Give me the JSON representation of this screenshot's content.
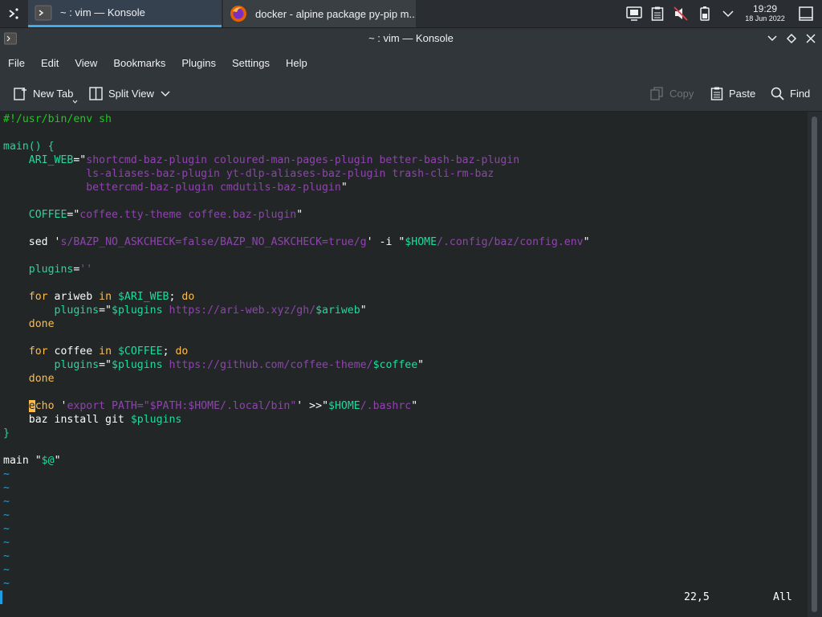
{
  "taskbar": {
    "launcher_icon": "application-launcher-icon",
    "tasks": [
      {
        "label": "~ : vim — Konsole",
        "icon": "konsole-icon",
        "active": true
      },
      {
        "label": "docker - alpine package py-pip m...",
        "icon": "firefox-icon",
        "active": false
      }
    ],
    "tray_icons": [
      "screen-icon",
      "clipboard-icon",
      "volume-muted-icon",
      "battery-icon",
      "chevron-up-icon"
    ],
    "clock": {
      "time": "19:29",
      "date": "18 Jun 2022"
    }
  },
  "window": {
    "title": "~ : vim — Konsole",
    "buttons": [
      "minimize-icon",
      "maximize-icon",
      "close-icon"
    ]
  },
  "menu": [
    "File",
    "Edit",
    "View",
    "Bookmarks",
    "Plugins",
    "Settings",
    "Help"
  ],
  "toolbar": {
    "new_tab": "New Tab",
    "split_view": "Split View",
    "copy": "Copy",
    "paste": "Paste",
    "find": "Find"
  },
  "editor": {
    "shebang": "#!/usr/bin/env sh",
    "func_decl": "main() {",
    "ari_name": "ARI_WEB",
    "ari_val1": "shortcmd-baz-plugin coloured-man-pages-plugin better-bash-baz-plugin",
    "ari_val2": "ls-aliases-baz-plugin yt-dlp-aliases-baz-plugin trash-cli-rm-baz",
    "ari_val3": "bettercmd-baz-plugin cmdutils-baz-plugin",
    "coffee_name": "COFFEE",
    "coffee_val": "coffee.tty-theme coffee.baz-plugin",
    "sed_cmd": "sed",
    "sed_expr": "s/BAZP_NO_ASKCHECK=false/BAZP_NO_ASKCHECK=true/g",
    "sed_opt": "-i",
    "home_var": "$HOME",
    "sed_path": "/.config/baz/config.env",
    "plugins_name": "plugins",
    "empty_str": "''",
    "kw_for": "for",
    "kw_in": "in",
    "kw_do": "do",
    "kw_done": "done",
    "loop1_var": "ariweb",
    "loop1_list": "$ARI_WEB",
    "plugins_ref": "$plugins",
    "loop1_url": "https://ari-web.xyz/gh/",
    "loop1_ref": "$ariweb",
    "loop2_var": "coffee",
    "loop2_list": "$COFFEE",
    "loop2_url": "https://github.com/coffee-theme/",
    "loop2_ref": "$coffee",
    "echo_first": "e",
    "echo_rest": "cho",
    "echo_str1": "export PATH=\"$PATH:$HOME/.local/bin\"",
    "redirect": " >>",
    "bashrc_path": "/.bashrc",
    "baz_cmd": "baz install git",
    "close_brace": "}",
    "main_call": "main",
    "args": "$@",
    "tilde": "~",
    "position": "22,5",
    "scroll": "All"
  }
}
